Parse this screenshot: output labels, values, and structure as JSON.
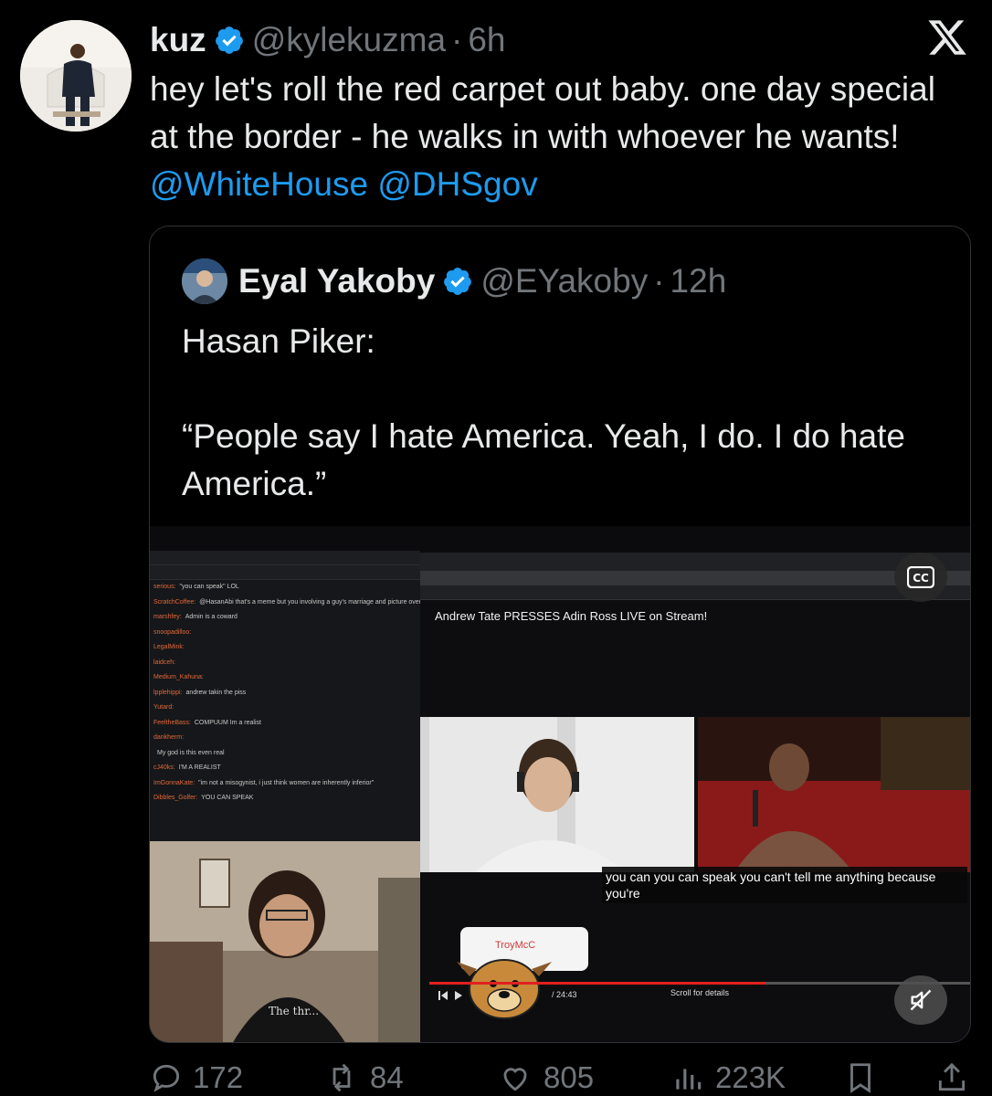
{
  "tweet": {
    "display_name": "kuz",
    "handle": "@kylekuzma",
    "separator": "·",
    "time": "6h",
    "text": "hey let's roll the red carpet out baby. one day special at the border - he walks in with whoever he wants!",
    "mentions": [
      "@WhiteHouse",
      "@DHSgov"
    ]
  },
  "quote": {
    "display_name": "Eyal Yakoby",
    "handle": "@EYakoby",
    "separator": "·",
    "time": "12h",
    "line1": "Hasan Piker:",
    "line2": "“People say I hate America. Yeah, I do. I do hate America.”"
  },
  "media": {
    "video_title": "Andrew Tate PRESSES Adin Ross LIVE on Stream!",
    "caption": "you can you can speak you can't tell me anything because you're",
    "time_label": "/ 24:43",
    "scroll_label": "Scroll for details",
    "sticker_text": "TroyMcC",
    "cc_label": "CC",
    "chat_lines": [
      {
        "user": "serious:",
        "msg": "\"you can speak\" LOL"
      },
      {
        "user": "ScratchCoffee:",
        "msg": "@HasanAbi that's a meme but you involving a guy's marriage and picture over a silly comment"
      },
      {
        "user": "marshfey:",
        "msg": "Admin is a coward"
      },
      {
        "user": "snoopadilloo:",
        "msg": ""
      },
      {
        "user": "LegalMink:",
        "msg": ""
      },
      {
        "user": "laidceh:",
        "msg": ""
      },
      {
        "user": "Medium_Kahuna:",
        "msg": ""
      },
      {
        "user": "lpplehippi:",
        "msg": "andrew takin the piss"
      },
      {
        "user": "Yutard:",
        "msg": ""
      },
      {
        "user": "FeeltheBass:",
        "msg": "COMPUUM Im a realist"
      },
      {
        "user": "dankherm:",
        "msg": ""
      },
      {
        "user": "",
        "msg": "My god is this even real"
      },
      {
        "user": "cJ40ks:",
        "msg": "I'M A REALIST"
      },
      {
        "user": "ImGonnaKate:",
        "msg": "\"im not a misogynist, i just think women are inherently inferior\""
      },
      {
        "user": "Dibbles_Golfer:",
        "msg": "YOU CAN SPEAK"
      }
    ]
  },
  "actions": {
    "replies": "172",
    "reposts": "84",
    "likes": "805",
    "views": "223K"
  },
  "colors": {
    "background": "#000000",
    "text": "#e7e9ea",
    "muted": "#71767b",
    "link": "#1d9bf0",
    "border": "#2f3336",
    "verified": "#1d9bf0"
  }
}
